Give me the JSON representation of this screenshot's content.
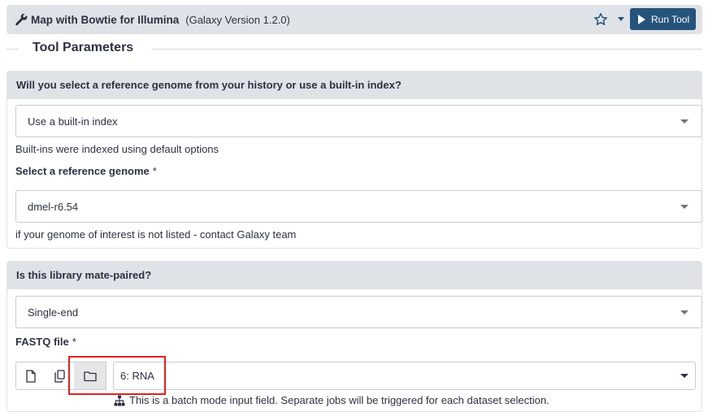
{
  "header": {
    "title": "Map with Bowtie for Illumina",
    "version": "(Galaxy Version 1.2.0)",
    "run_label": "Run Tool"
  },
  "section": {
    "title": "Tool Parameters"
  },
  "panel1": {
    "question": "Will you select a reference genome from your history or use a built-in index?",
    "select_value": "Use a built-in index",
    "help1": "Built-ins were indexed using default options",
    "label": "Select a reference genome",
    "required": "*",
    "genome_value": "dmel-r6.54",
    "help2": "if your genome of interest is not listed - contact Galaxy team"
  },
  "panel2": {
    "question": "Is this library mate-paired?",
    "select_value": "Single-end",
    "label": "FASTQ file",
    "required": "*",
    "dataset_value": "6: RNA",
    "batch_note": "This is a batch mode input field. Separate jobs will be triggered for each dataset selection."
  },
  "colors": {
    "primary": "#25537b",
    "panel_header": "#dfe3e8",
    "highlight": "#e02020"
  }
}
